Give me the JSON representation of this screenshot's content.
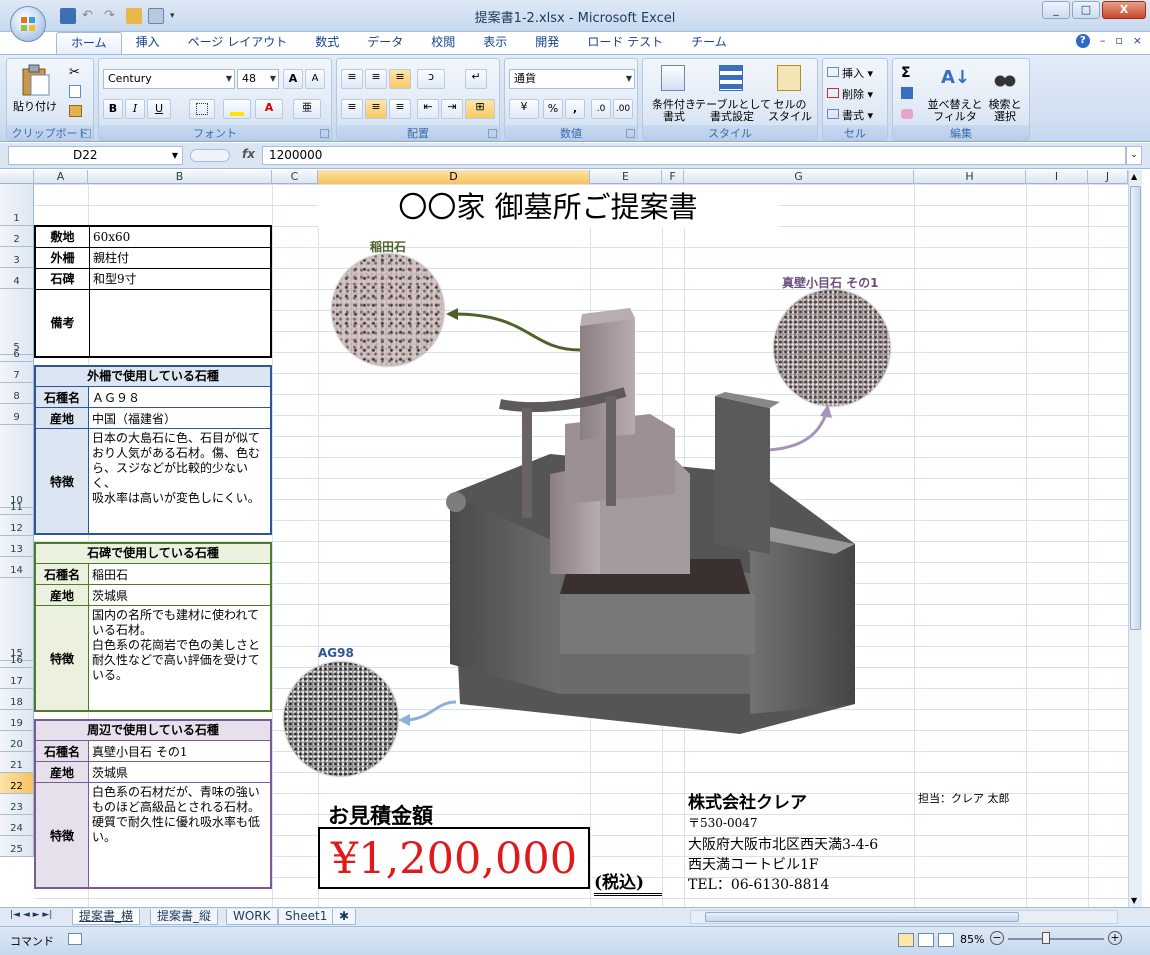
{
  "window": {
    "title": "提案書1-2.xlsx - Microsoft Excel",
    "min": "_",
    "max": "□",
    "close": "X"
  },
  "tabs": [
    "ホーム",
    "挿入",
    "ページ レイアウト",
    "数式",
    "データ",
    "校閲",
    "表示",
    "開発",
    "ロード テスト",
    "チーム"
  ],
  "ribbon": {
    "clipboard": {
      "paste": "貼り付け",
      "label": "クリップボード"
    },
    "font": {
      "name": "Century",
      "size": "48",
      "bold": "B",
      "italic": "I",
      "underline": "U",
      "label": "フォント"
    },
    "alignment": {
      "label": "配置"
    },
    "number": {
      "format": "通貨",
      "percent": "%",
      "comma": ",",
      "label": "数値"
    },
    "styles": {
      "conditional": "条件付き\n書式",
      "table": "テーブルとして\n書式設定",
      "cell": "セルの\nスタイル",
      "label": "スタイル"
    },
    "cells": {
      "insert": "挿入",
      "delete": "削除",
      "format": "書式",
      "label": "セル"
    },
    "editing": {
      "sigma": "Σ",
      "sort": "並べ替えと\nフィルタ",
      "find": "検索と\n選択",
      "label": "編集"
    }
  },
  "formula_bar": {
    "name_box": "D22",
    "fx": "fx",
    "value": "1200000"
  },
  "columns": [
    "A",
    "B",
    "C",
    "D",
    "E",
    "F",
    "G",
    "H",
    "I",
    "J"
  ],
  "rows": [
    "1",
    "2",
    "3",
    "4",
    "5",
    "6",
    "7",
    "8",
    "9",
    "10",
    "11",
    "12",
    "13",
    "14",
    "15",
    "16",
    "17",
    "18",
    "19",
    "20",
    "21",
    "22",
    "23",
    "24",
    "25"
  ],
  "sheet": {
    "title": "〇〇家 御墓所ご提案書",
    "spec": [
      {
        "label": "敷地",
        "value": "60x60"
      },
      {
        "label": "外柵",
        "value": "親柱付"
      },
      {
        "label": "石碑",
        "value": "和型9寸"
      },
      {
        "label": "備考",
        "value": ""
      }
    ],
    "sections": [
      {
        "head": "外柵で使用している石種",
        "color": "#2f5597",
        "bg": "#dce6f2",
        "name_label": "石種名",
        "name": "ＡＧ９８",
        "origin_label": "産地",
        "origin": "中国（福建省）",
        "feature_label": "特徴",
        "feature": "日本の大島石に色、石目が似ており人気がある石材。傷、色むら、スジなどが比較的少ないく、\n吸水率は高いが変色しにくい。"
      },
      {
        "head": "石碑で使用している石種",
        "color": "#4f7a28",
        "bg": "#ebf1de",
        "name_label": "石種名",
        "name": "稲田石",
        "origin_label": "産地",
        "origin": "茨城県",
        "feature_label": "特徴",
        "feature": "国内の名所でも建材に使われている石材。\n白色系の花崗岩で色の美しさと耐久性などで高い評価を受けている。"
      },
      {
        "head": "周辺で使用している石種",
        "color": "#7a5c94",
        "bg": "#e5e0ec",
        "name_label": "石種名",
        "name": "真壁小目石 その1",
        "origin_label": "産地",
        "origin": "茨城県",
        "feature_label": "特徴",
        "feature": "白色系の石材だが、青味の強いものほど高級品とされる石材。\n硬質で耐久性に優れ吸水率も低い。"
      }
    ],
    "stones": {
      "inada": "稲田石",
      "makabe": "真壁小目石 その1",
      "ag98": "AG98"
    },
    "estimate_label": "お見積金額",
    "price": "¥1,200,000",
    "tax": "(税込)",
    "company": {
      "name": "株式会社クレア",
      "contact": "担当：クレア 太郎",
      "zip": "〒530-0047",
      "address": "大阪府大阪市北区西天満3-4-6",
      "building": "西天満コートビル1F",
      "tel": "TEL：06-6130-8814"
    }
  },
  "sheet_tabs": [
    "提案書_横",
    "提案書_縦",
    "WORK",
    "Sheet1"
  ],
  "status": {
    "mode": "コマンド",
    "zoom": "85%"
  }
}
